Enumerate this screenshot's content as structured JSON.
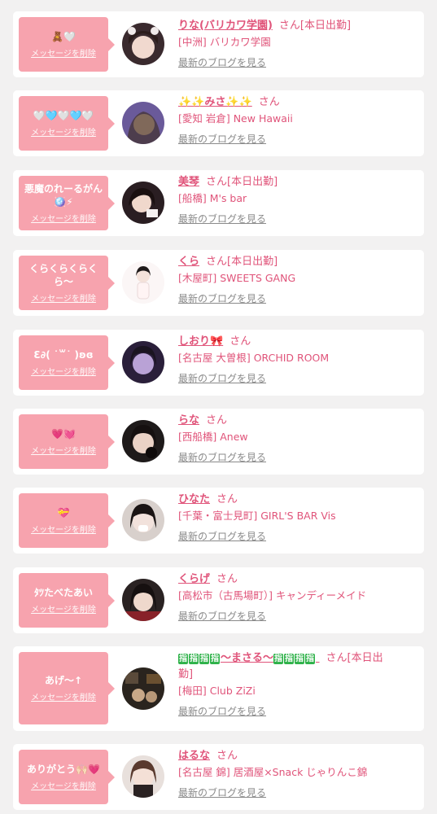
{
  "delete_label": "メッセージを削除",
  "blog_label": "最新のブログを見る",
  "colors": {
    "bubble": "#f7a3ae",
    "name": "#e0547a",
    "muted": "#8a8a8a"
  },
  "items": [
    {
      "message": "🧸🤍",
      "name": "りな(バリカワ学園)",
      "san": "さん[本日出勤]",
      "shop": "[中洲] バリカワ学園",
      "avatar": {
        "bg": "#3a2a2e",
        "face": "#f1d9cf",
        "hair": "#2c1d1c"
      }
    },
    {
      "message": "🤍🩵🤍🩵🤍",
      "name": "✨✨みさ✨✨",
      "san": "さん",
      "shop": "[愛知 岩倉] New Hawaii",
      "avatar": {
        "bg": "#6a5a9a",
        "face": "#e8c8b8",
        "hair": "#3a2a1a"
      }
    },
    {
      "message": "悪魔のれーるがん🪩⚡",
      "name": "美琴",
      "san": "さん[本日出勤]",
      "shop": "[船橋] M's bar",
      "avatar": {
        "bg": "#2a1e22",
        "face": "#f0d8cc",
        "hair": "#1a1010"
      }
    },
    {
      "message": "くらくらくらくら〜",
      "name": "くら",
      "san": "さん[本日出勤]",
      "shop": "[木屋町] SWEETS GANG",
      "avatar": {
        "bg": "#fbf6f6",
        "face": "#f4e2da",
        "hair": "#1f1a1a"
      }
    },
    {
      "message": "Ɛ∂( ˙꒳˙ )ʚɞ",
      "name": "しおり🎀",
      "san": "さん",
      "shop": "[名古屋 大曽根] ORCHID ROOM",
      "avatar": {
        "bg": "#2a1f3a",
        "face": "#b9a2d6",
        "hair": "#1a1420"
      }
    },
    {
      "message": "💗💓",
      "name": "らな",
      "san": "さん",
      "shop": "[西船橋] Anew",
      "avatar": {
        "bg": "#1e1a1a",
        "face": "#ead2c6",
        "hair": "#151010"
      }
    },
    {
      "message": "💝",
      "name": "ひなた",
      "san": "さん",
      "shop": "[千葉・富士見町] GIRL'S BAR Vis",
      "avatar": {
        "bg": "#d8d0cc",
        "face": "#f2e2dc",
        "hair": "#1a1414"
      }
    },
    {
      "message": "ﾀﾂたべたあい",
      "name": "くらげ",
      "san": "さん",
      "shop": "[高松市（古馬場町）] キャンディーメイド",
      "avatar": {
        "bg": "#2a2222",
        "face": "#efd8cc",
        "hair": "#161010"
      }
    },
    {
      "message": "あげ〜↑",
      "name_prefix": [
        "指",
        "指",
        "指",
        "指"
      ],
      "name": "〜まさる〜",
      "name_suffix": [
        "指",
        "指",
        "指",
        "指"
      ],
      "san": "さん[本日出",
      "san_cont": "勤]",
      "shop": "[梅田] Club ZiZi",
      "avatar": {
        "bg": "#2a241e",
        "face": "#c8a888",
        "hair": "#3a2a1a"
      }
    },
    {
      "message": "ありがとう🙌🏻💗",
      "name": "はるな",
      "san": "さん",
      "shop": "[名古屋 錦] 居酒屋×Snack じゃりんこ錦",
      "avatar": {
        "bg": "#e8e0dc",
        "face": "#f4e0d6",
        "hair": "#5a3a2e"
      }
    }
  ]
}
